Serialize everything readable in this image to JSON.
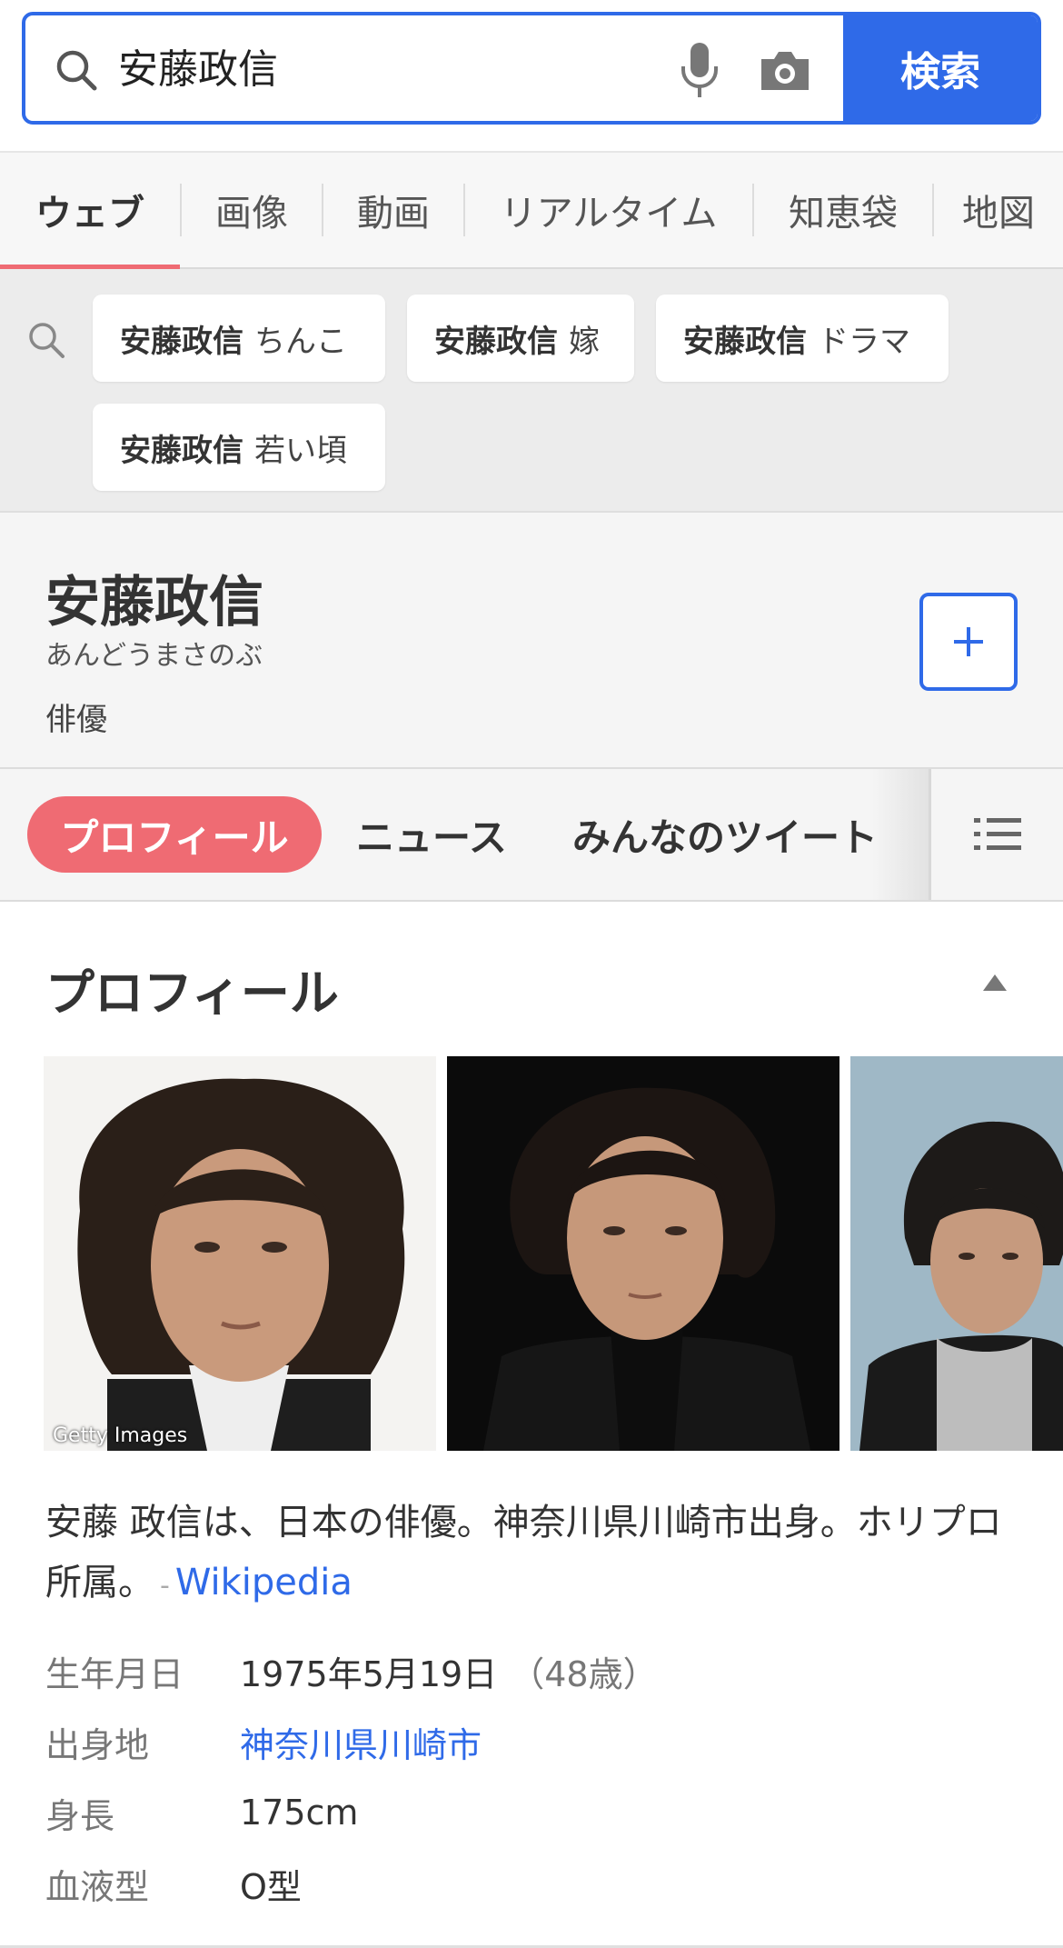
{
  "search": {
    "query": "安藤政信",
    "button_label": "検索"
  },
  "tabs": [
    {
      "label": "ウェブ",
      "active": true
    },
    {
      "label": "画像"
    },
    {
      "label": "動画"
    },
    {
      "label": "リアルタイム"
    },
    {
      "label": "知恵袋"
    },
    {
      "label": "地図"
    }
  ],
  "related": [
    {
      "bold": "安藤政信",
      "rest": "ちんこ"
    },
    {
      "bold": "安藤政信",
      "rest": "嫁"
    },
    {
      "bold": "安藤政信",
      "rest": "ドラマ"
    },
    {
      "bold": "安藤政信",
      "rest": "若い頃"
    }
  ],
  "entity": {
    "name": "安藤政信",
    "reading": "あんどうまさのぶ",
    "type": "俳優"
  },
  "subtabs": {
    "active": "プロフィール",
    "items": [
      "ニュース",
      "みんなのツイート"
    ]
  },
  "profile": {
    "title": "プロフィール",
    "photo_credit": "Getty Images",
    "description": "安藤 政信は、日本の俳優。神奈川県川崎市出身。ホリプロ所属。",
    "source_sep": "-",
    "source": "Wikipedia",
    "info": [
      {
        "label": "生年月日",
        "value": "1975年5月19日",
        "sub": "（48歳）"
      },
      {
        "label": "出身地",
        "value": "神奈川県川崎市",
        "link": true
      },
      {
        "label": "身長",
        "value": "175cm"
      },
      {
        "label": "血液型",
        "value": "O型"
      }
    ]
  },
  "colors": {
    "accent_blue": "#2f6ae8",
    "accent_pink": "#ef6b73"
  },
  "icons": [
    "search-icon",
    "mic-icon",
    "camera-icon",
    "plus-icon",
    "list-menu-icon",
    "caret-up-icon"
  ]
}
